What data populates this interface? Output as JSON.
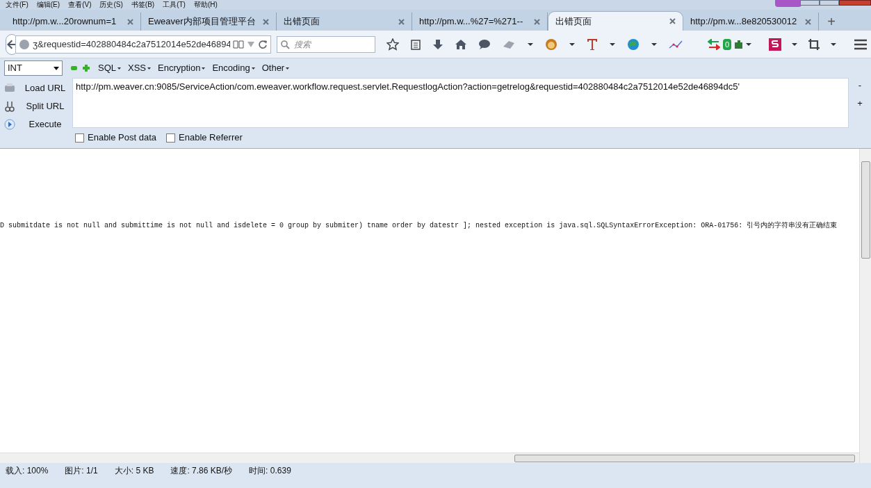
{
  "menu": [
    "文件(F)",
    "编辑(E)",
    "查看(V)",
    "历史(S)",
    "书签(B)",
    "工具(T)",
    "帮助(H)"
  ],
  "tabs": [
    {
      "label": "http://pm.w...20rownum=1",
      "selected": false
    },
    {
      "label": "Eweaver内部项目管理平台",
      "selected": false
    },
    {
      "label": "出错页面",
      "selected": false
    },
    {
      "label": "http://pm.w...%27=%271--",
      "selected": false
    },
    {
      "label": "出错页面",
      "selected": true
    },
    {
      "label": "http://pm.w...8e820530012",
      "selected": false
    }
  ],
  "new_tab": "+",
  "address_bar": {
    "value": "ʒ&requestid=402880484c2a7512014e52de46894"
  },
  "search": {
    "placeholder": "搜索"
  },
  "toolbar_badge": "0",
  "hackbar": {
    "select": "INT",
    "menus": [
      "SQL",
      "XSS",
      "Encryption",
      "Encoding",
      "Other"
    ],
    "actions": [
      {
        "kind": "load",
        "label": "Load URL"
      },
      {
        "kind": "split",
        "label": "Split URL"
      },
      {
        "kind": "execute",
        "label": "Execute"
      }
    ],
    "url": "http://pm.weaver.cn:9085/ServiceAction/com.eweaver.workflow.request.servlet.RequestlogAction?action=getrelog&requestid=402880484c2a7512014e52de46894dc5'",
    "side_buttons": [
      "-",
      "+"
    ],
    "options": [
      {
        "label": "Enable Post data",
        "checked": false
      },
      {
        "label": "Enable Referrer",
        "checked": false
      }
    ]
  },
  "content": {
    "error_text": "D submitdate is not null and submittime is not null and isdelete = 0 group by submiter) tname order by datestr ]; nested exception is java.sql.SQLSyntaxErrorException: ORA-01756: 引号内的字符串没有正确结束"
  },
  "status_bar": [
    "载入: 100%",
    "图片: 1/1",
    "大小: 5 KB",
    "速度: 7.86 KB/秒",
    "时间: 0.639"
  ]
}
